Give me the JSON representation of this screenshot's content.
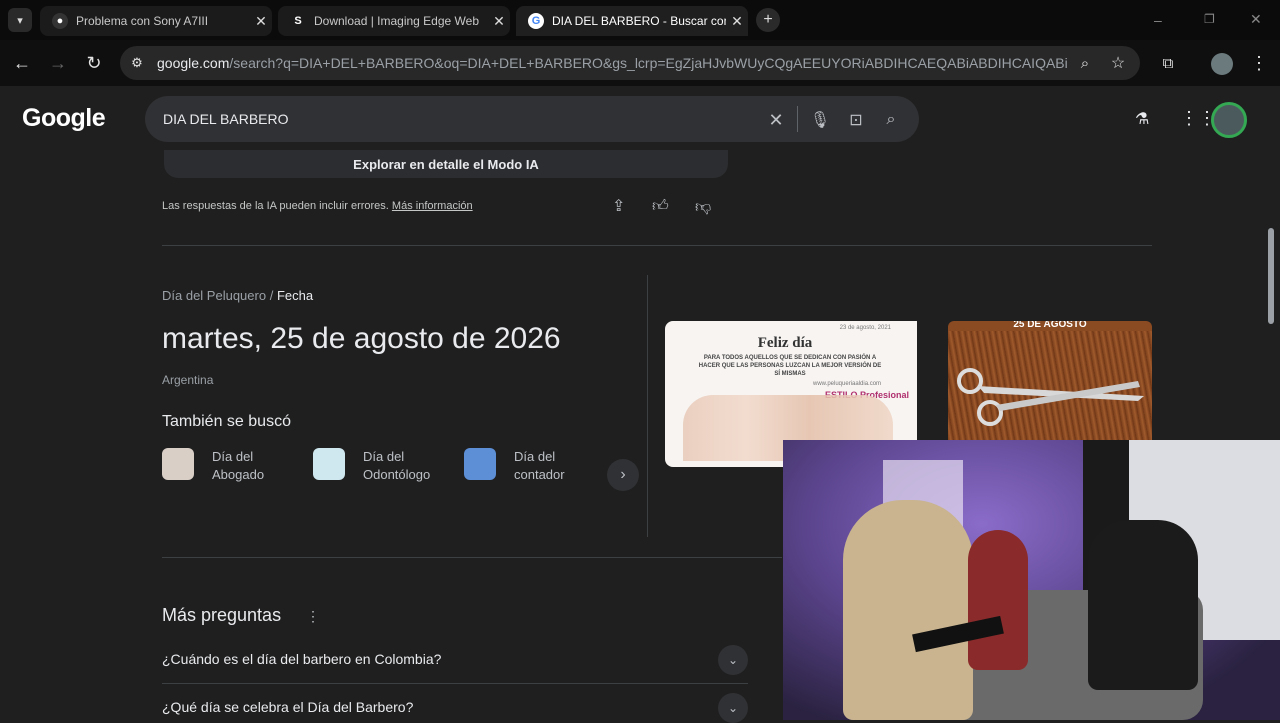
{
  "browser": {
    "tabs": [
      {
        "title": "Problema con Sony A7III",
        "favicon": "github-icon"
      },
      {
        "title": "Download | Imaging Edge Web",
        "favicon": "s-icon"
      },
      {
        "title": "DIA DEL BARBERO - Buscar con Google",
        "favicon": "google-icon",
        "active": true
      }
    ],
    "url_host": "google.com",
    "url_rest": "/search?q=DIA+DEL+BARBERO&oq=DIA+DEL+BARBERO&gs_lcrp=EgZjaHJvbWUyCQgAEEUYORiABDIHCAEQABiABDIHCAIQABiABDI..."
  },
  "search": {
    "logo": "Google",
    "query": "DIA DEL BARBERO"
  },
  "ai_overview": {
    "explore_label": "Explorar en detalle el Modo IA",
    "disclaimer": "Las respuestas de la IA pueden incluir errores.",
    "more_info": "Más información"
  },
  "date_card": {
    "crumb_parent": "Día del Peluquero",
    "crumb_sep": "/",
    "crumb_current": "Fecha",
    "date": "martes, 25 de agosto de 2026",
    "country": "Argentina",
    "also_searched_title": "También se buscó",
    "related": [
      {
        "label": "Día del Abogado"
      },
      {
        "label": "Día del Odontólogo"
      },
      {
        "label": "Día del contador"
      }
    ],
    "image1": {
      "title": "Feliz día",
      "date": "23 de agosto, 2021",
      "body": "PARA TODOS AQUELLOS QUE SE DEDICAN CON PASIÓN A HACER QUE LAS PERSONAS LUZCAN LA MEJOR VERSIÓN DE SÍ MISMAS",
      "site": "www.peluqueriaaldia.com",
      "brand": "ESTILO Profesional"
    },
    "image2": {
      "caption": "25 DE AGOSTO"
    }
  },
  "more_questions": {
    "title": "Más preguntas",
    "items": [
      {
        "q": "¿Cuándo es el día del barbero en Colombia?"
      },
      {
        "q": "¿Qué día se celebra el Día del Barbero?"
      }
    ]
  }
}
